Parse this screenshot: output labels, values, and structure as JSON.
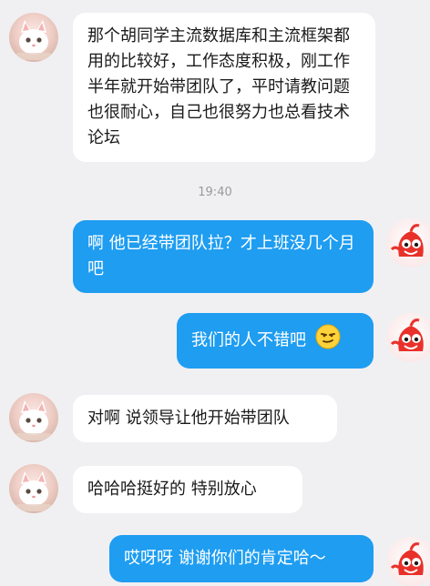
{
  "messages": [
    {
      "side": "in",
      "text": "那个胡同学主流数据库和主流框架都用的比较好，工作态度积极，刚工作半年就开始带团队了，平时请教问题也很耐心，自己也很努力也总看技术论坛"
    },
    {
      "side": "time",
      "text": "19:40"
    },
    {
      "side": "out",
      "text": "啊 他已经带团队拉？才上班没几个月吧"
    },
    {
      "side": "out",
      "text": "我们的人不错吧",
      "emoji": "smirk-face-icon"
    },
    {
      "side": "in",
      "text": "对啊 说领导让他开始带团队"
    },
    {
      "side": "in",
      "text": "哈哈哈挺好的 特别放心"
    },
    {
      "side": "out",
      "text": "哎呀呀 谢谢你们的肯定哈～"
    }
  ],
  "avatars": {
    "incoming": "kitten-avatar-icon",
    "outgoing": "red-mascot-avatar-icon"
  },
  "colors": {
    "background": "#f0f0f3",
    "incoming_bubble": "#ffffff",
    "outgoing_bubble": "#1e9df1",
    "outgoing_text": "#ffffff",
    "incoming_text": "#1a1a1a",
    "mascot_red": "#e8312a"
  }
}
